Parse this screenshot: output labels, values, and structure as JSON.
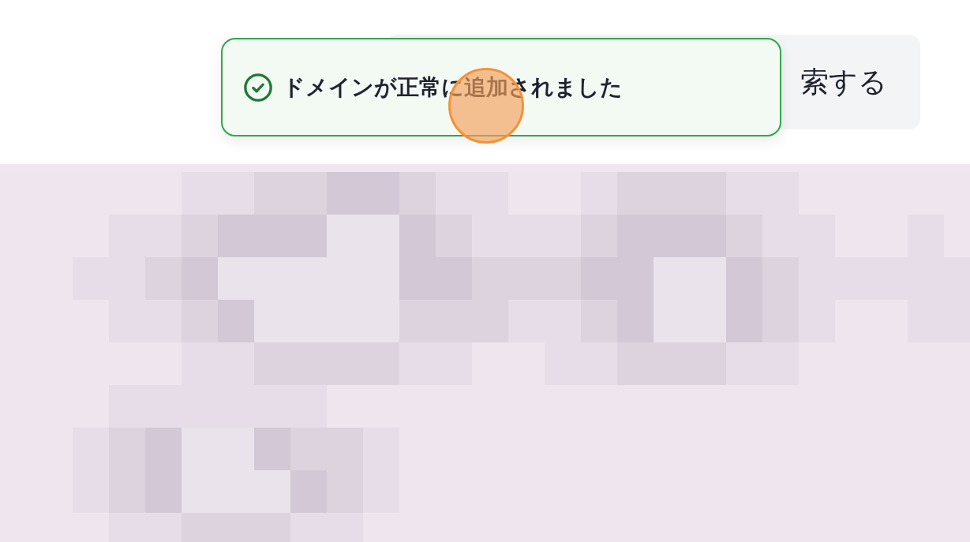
{
  "search_button": {
    "label": "索する"
  },
  "toast": {
    "kind": "success",
    "message": "ドメインが正常に追加されました"
  }
}
